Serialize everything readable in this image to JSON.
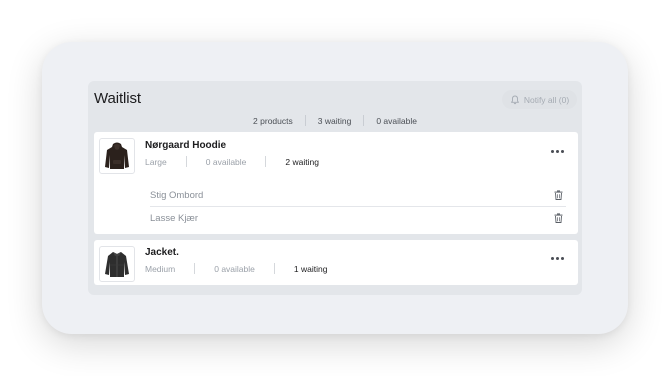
{
  "waitlist": {
    "title": "Waitlist",
    "notify_all_label": "Notify all (0)",
    "summary": {
      "products": "2 products",
      "waiting": "3 waiting",
      "available": "0 available"
    },
    "colors": {
      "accent_text": "#1c1c1e",
      "muted_text": "#9ba1a9",
      "panel_bg": "#e3e6ea"
    },
    "products": [
      {
        "name": "Nørgaard Hoodie",
        "size": "Large",
        "available": "0 available",
        "waiting": "2 waiting",
        "thumbnail_icon": "hoodie-icon",
        "waiters": [
          {
            "name": "Stig Ombord"
          },
          {
            "name": "Lasse Kjær"
          }
        ]
      },
      {
        "name": "Jacket.",
        "size": "Medium",
        "available": "0 available",
        "waiting": "1 waiting",
        "thumbnail_icon": "jacket-icon",
        "waiters": []
      }
    ]
  }
}
